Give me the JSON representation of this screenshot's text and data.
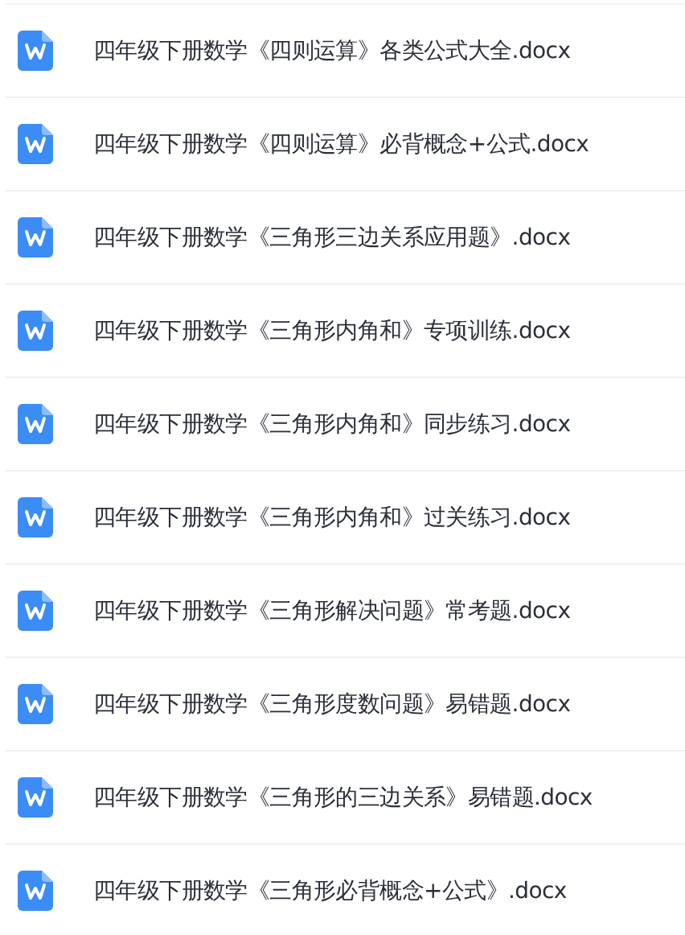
{
  "files": [
    {
      "name": "四年级下册数学《四则运算》各类公式大全.docx"
    },
    {
      "name": "四年级下册数学《四则运算》必背概念+公式.docx"
    },
    {
      "name": "四年级下册数学《三角形三边关系应用题》.docx"
    },
    {
      "name": "四年级下册数学《三角形内角和》专项训练.docx"
    },
    {
      "name": "四年级下册数学《三角形内角和》同步练习.docx"
    },
    {
      "name": "四年级下册数学《三角形内角和》过关练习.docx"
    },
    {
      "name": "四年级下册数学《三角形解决问题》常考题.docx"
    },
    {
      "name": "四年级下册数学《三角形度数问题》易错题.docx"
    },
    {
      "name": "四年级下册数学《三角形的三边关系》易错题.docx"
    },
    {
      "name": "四年级下册数学《三角形必背概念+公式》.docx"
    }
  ]
}
